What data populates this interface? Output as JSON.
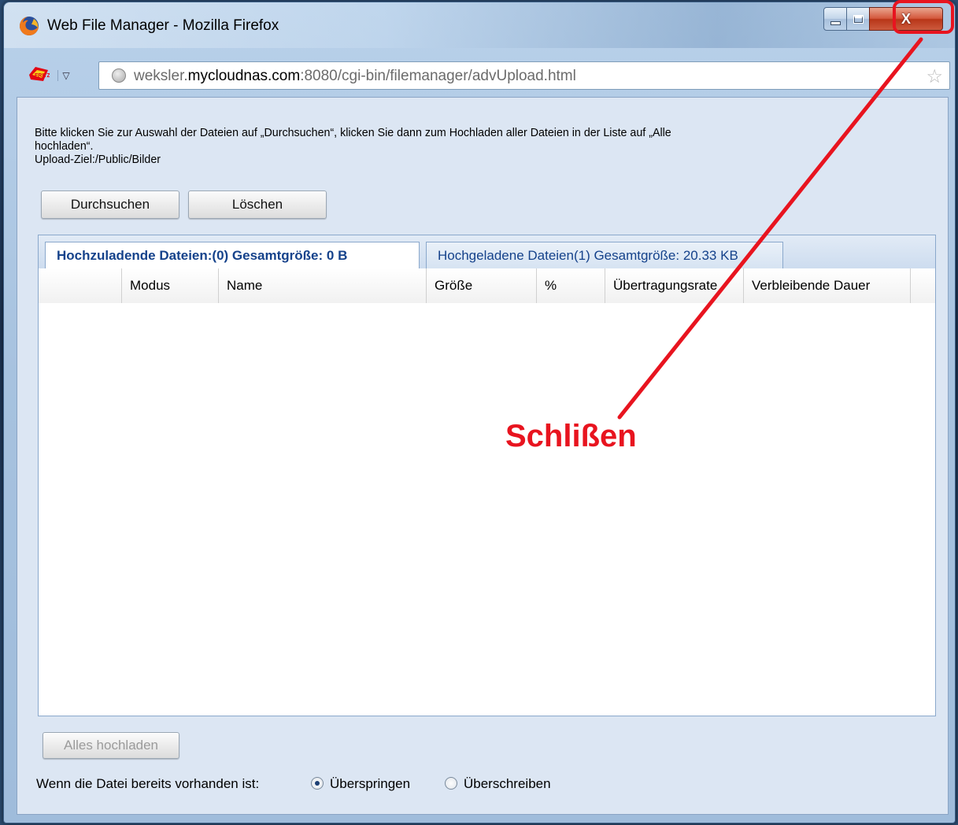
{
  "window": {
    "title": "Web File Manager - Mozilla Firefox",
    "close_glyph": "X"
  },
  "navbar": {
    "url_prefix": "weksler.",
    "url_host": "mycloudnas.com",
    "url_rest": ":8080/cgi-bin/filemanager/advUpload.html",
    "dropdown_glyph": "▽",
    "star_glyph": "☆"
  },
  "content": {
    "instruction_line1": "Bitte klicken Sie zur Auswahl der Dateien auf „Durchsuchen“, klicken Sie dann zum Hochladen aller Dateien in der Liste auf „Alle",
    "instruction_line2": "hochladen“.",
    "instruction_line3": "Upload-Ziel:/Public/Bilder",
    "browse_label": "Durchsuchen",
    "delete_label": "Löschen",
    "upload_all_label": "Alles hochladen",
    "tabs": [
      {
        "label": "Hochzuladende Dateien:(0) Gesamtgröße: 0 B"
      },
      {
        "label": "Hochgeladene Dateien(1) Gesamtgröße: 20.33 KB"
      }
    ],
    "columns": [
      "",
      "Modus",
      "Name",
      "Größe",
      "%",
      "Übertragungsrate",
      "Verbleibende Dauer",
      ""
    ],
    "existing_label": "Wenn die Datei bereits vorhanden ist:",
    "radio_skip": "Überspringen",
    "radio_overwrite": "Überschreiben",
    "radio_selected": "Überspringen"
  },
  "annotation": {
    "text": "Schlißen",
    "color": "#e8141f"
  },
  "colors": {
    "tab_text": "#15428b",
    "annotation_red": "#e8141f"
  }
}
